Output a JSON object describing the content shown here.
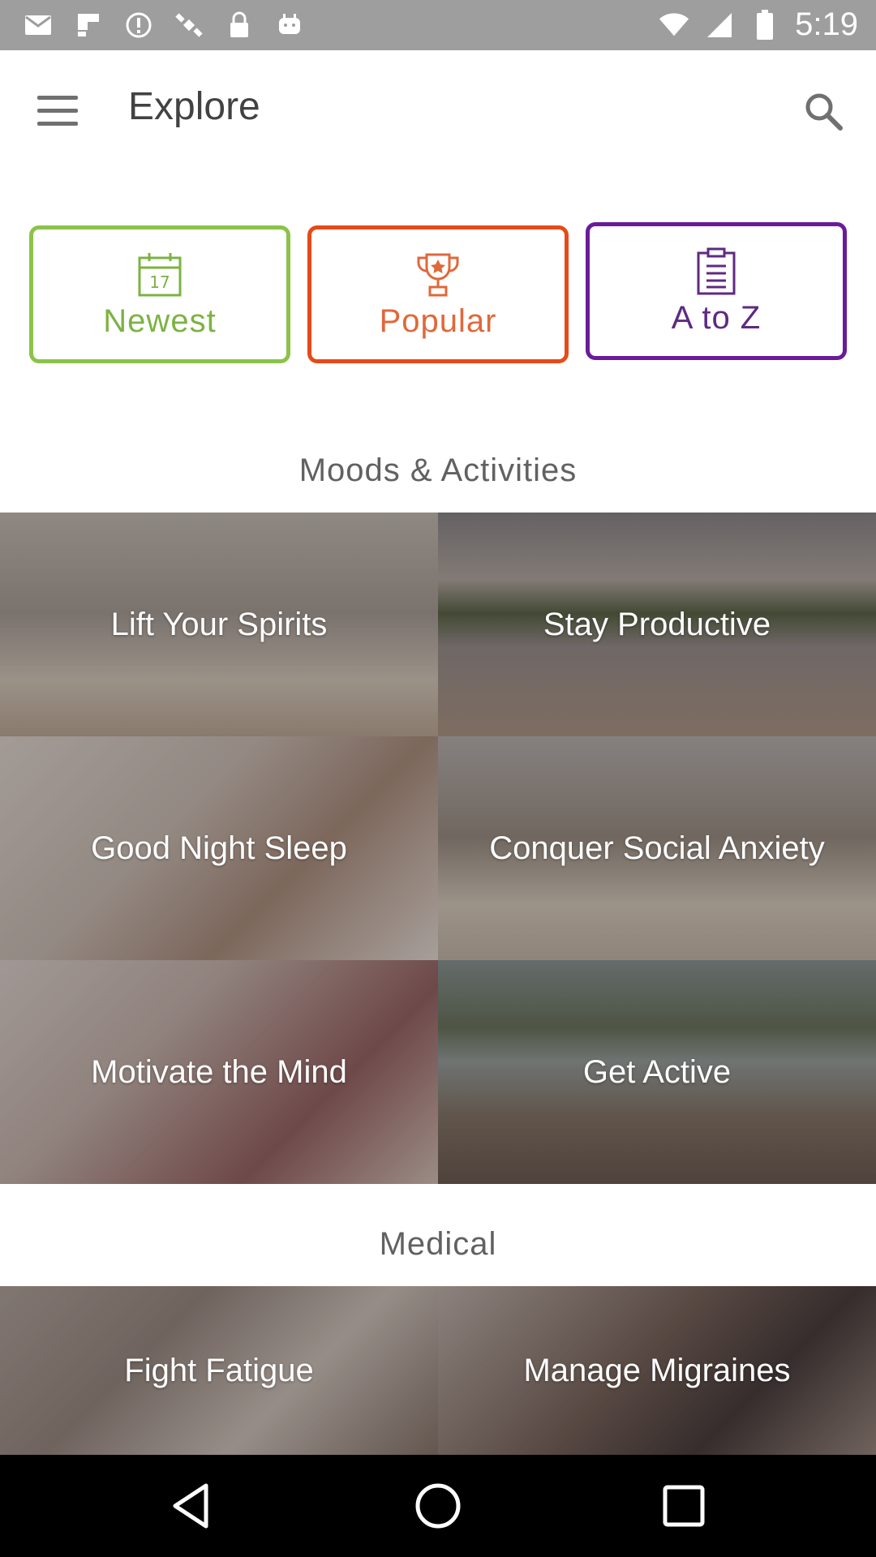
{
  "status_bar": {
    "time": "5:19",
    "icons": [
      "mail-icon",
      "flipboard-icon",
      "alert-icon",
      "satellite-icon",
      "lock-icon",
      "android-icon",
      "wifi-icon",
      "signal-icon",
      "battery-icon"
    ]
  },
  "app_bar": {
    "title": "Explore",
    "menu_icon": "menu-icon",
    "search_icon": "search-icon"
  },
  "filters": [
    {
      "label": "Newest",
      "icon": "calendar-icon",
      "icon_text": "17",
      "color": "#8bc34a"
    },
    {
      "label": "Popular",
      "icon": "trophy-icon",
      "color": "#e64a19"
    },
    {
      "label": "A to Z",
      "icon": "clipboard-icon",
      "color": "#6a1b9a"
    }
  ],
  "sections": {
    "moods": {
      "title": "Moods & Activities",
      "items": [
        "Lift Your Spirits",
        "Stay Productive",
        "Good Night Sleep",
        "Conquer Social Anxiety",
        "Motivate the Mind",
        "Get Active"
      ]
    },
    "medical": {
      "title": "Medical",
      "items": [
        "Fight Fatigue",
        "Manage Migraines"
      ]
    }
  },
  "nav_bar": {
    "icons": [
      "back-icon",
      "home-icon",
      "recents-icon"
    ]
  }
}
